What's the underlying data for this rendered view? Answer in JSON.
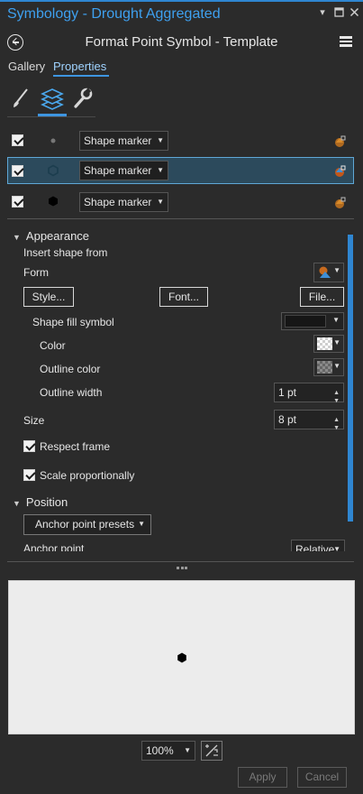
{
  "window": {
    "title": "Symbology - Drought Aggregated",
    "pin_icon": "dropdown-arrow-icon",
    "restore_icon": "restore-icon",
    "close_icon": "close-icon"
  },
  "header": {
    "title": "Format Point Symbol - Template",
    "back_icon": "back-arrow-icon",
    "menu_icon": "hamburger-menu-icon"
  },
  "tabs": [
    {
      "label": "Gallery",
      "active": false
    },
    {
      "label": "Properties",
      "active": true
    }
  ],
  "icon_tabs": [
    "paintbrush-icon",
    "layers-icon",
    "wrench-icon"
  ],
  "layers": [
    {
      "checked": true,
      "marker": "Shape marker",
      "selected": false
    },
    {
      "checked": true,
      "marker": "Shape marker",
      "selected": true
    },
    {
      "checked": true,
      "marker": "Shape marker",
      "selected": false
    }
  ],
  "appearance": {
    "heading": "Appearance",
    "insert_shape_from": "Insert shape from",
    "form_label": "Form",
    "style_button": "Style...",
    "font_button": "Font...",
    "file_button": "File...",
    "shape_fill_symbol": "Shape fill symbol",
    "color_label": "Color",
    "outline_color_label": "Outline color",
    "outline_width_label": "Outline width",
    "outline_width_value": "1 pt",
    "size_label": "Size",
    "size_value": "8 pt",
    "respect_frame": "Respect frame",
    "scale_proportionally": "Scale proportionally"
  },
  "position": {
    "heading": "Position",
    "anchor_presets": "Anchor point presets",
    "anchor_point": "Anchor point",
    "anchor_point_value": "Relative"
  },
  "preview": {
    "zoom": "100%"
  },
  "footer": {
    "apply": "Apply",
    "cancel": "Cancel"
  },
  "colors": {
    "accent": "#2f86d1",
    "selected_row": "#2c4a5c",
    "title_text": "#3ea0ef"
  }
}
